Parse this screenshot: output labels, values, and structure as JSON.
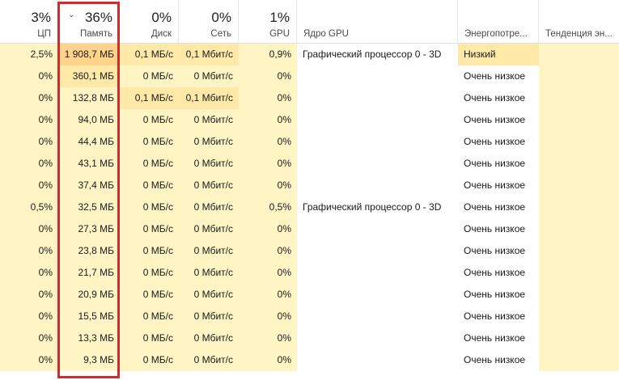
{
  "header": {
    "cpu": {
      "pct": "3%",
      "label": "ЦП"
    },
    "memory": {
      "pct": "36%",
      "label": "Память",
      "sort_icon": "chevron-down-icon"
    },
    "disk": {
      "pct": "0%",
      "label": "Диск"
    },
    "network": {
      "pct": "0%",
      "label": "Сеть"
    },
    "gpu": {
      "pct": "1%",
      "label": "GPU"
    },
    "gpu_engine": {
      "label": "Ядро GPU"
    },
    "power": {
      "label": "Энергопотре..."
    },
    "power_trend": {
      "label": "Тенденция эн..."
    }
  },
  "rows": [
    {
      "cpu": "2,5%",
      "mem": "1 908,7 МБ",
      "disk": "0,1 МБ/с",
      "net": "0,1 Мбит/с",
      "gpu": "0,9%",
      "engine": "Графический процессор 0 - 3D",
      "power": "Низкий"
    },
    {
      "cpu": "0%",
      "mem": "360,1 МБ",
      "disk": "0 МБ/с",
      "net": "0 Мбит/с",
      "gpu": "0%",
      "engine": "",
      "power": "Очень низкое"
    },
    {
      "cpu": "0%",
      "mem": "132,8 МБ",
      "disk": "0,1 МБ/с",
      "net": "0,1 Мбит/с",
      "gpu": "0%",
      "engine": "",
      "power": "Очень низкое"
    },
    {
      "cpu": "0%",
      "mem": "94,0 МБ",
      "disk": "0 МБ/с",
      "net": "0 Мбит/с",
      "gpu": "0%",
      "engine": "",
      "power": "Очень низкое"
    },
    {
      "cpu": "0%",
      "mem": "44,4 МБ",
      "disk": "0 МБ/с",
      "net": "0 Мбит/с",
      "gpu": "0%",
      "engine": "",
      "power": "Очень низкое"
    },
    {
      "cpu": "0%",
      "mem": "43,1 МБ",
      "disk": "0 МБ/с",
      "net": "0 Мбит/с",
      "gpu": "0%",
      "engine": "",
      "power": "Очень низкое"
    },
    {
      "cpu": "0%",
      "mem": "37,4 МБ",
      "disk": "0 МБ/с",
      "net": "0 Мбит/с",
      "gpu": "0%",
      "engine": "",
      "power": "Очень низкое"
    },
    {
      "cpu": "0,5%",
      "mem": "32,5 МБ",
      "disk": "0 МБ/с",
      "net": "0 Мбит/с",
      "gpu": "0,5%",
      "engine": "Графический процессор 0 - 3D",
      "power": "Очень низкое"
    },
    {
      "cpu": "0%",
      "mem": "27,3 МБ",
      "disk": "0 МБ/с",
      "net": "0 Мбит/с",
      "gpu": "0%",
      "engine": "",
      "power": "Очень низкое"
    },
    {
      "cpu": "0%",
      "mem": "23,8 МБ",
      "disk": "0 МБ/с",
      "net": "0 Мбит/с",
      "gpu": "0%",
      "engine": "",
      "power": "Очень низкое"
    },
    {
      "cpu": "0%",
      "mem": "21,7 МБ",
      "disk": "0 МБ/с",
      "net": "0 Мбит/с",
      "gpu": "0%",
      "engine": "",
      "power": "Очень низкое"
    },
    {
      "cpu": "0%",
      "mem": "20,9 МБ",
      "disk": "0 МБ/с",
      "net": "0 Мбит/с",
      "gpu": "0%",
      "engine": "",
      "power": "Очень низкое"
    },
    {
      "cpu": "0%",
      "mem": "15,5 МБ",
      "disk": "0 МБ/с",
      "net": "0 Мбит/с",
      "gpu": "0%",
      "engine": "",
      "power": "Очень низкое"
    },
    {
      "cpu": "0%",
      "mem": "13,3 МБ",
      "disk": "0 МБ/с",
      "net": "0 Мбит/с",
      "gpu": "0%",
      "engine": "",
      "power": "Очень низкое"
    },
    {
      "cpu": "0%",
      "mem": "9,3 МБ",
      "disk": "0 МБ/с",
      "net": "0 Мбит/с",
      "gpu": "0%",
      "engine": "",
      "power": "Очень низкое"
    }
  ],
  "colors": {
    "heat_light": "#fff4c4",
    "heat_mid": "#ffe9a8",
    "heat_strong": "#ffd389",
    "highlight_border": "#d32b2b"
  }
}
